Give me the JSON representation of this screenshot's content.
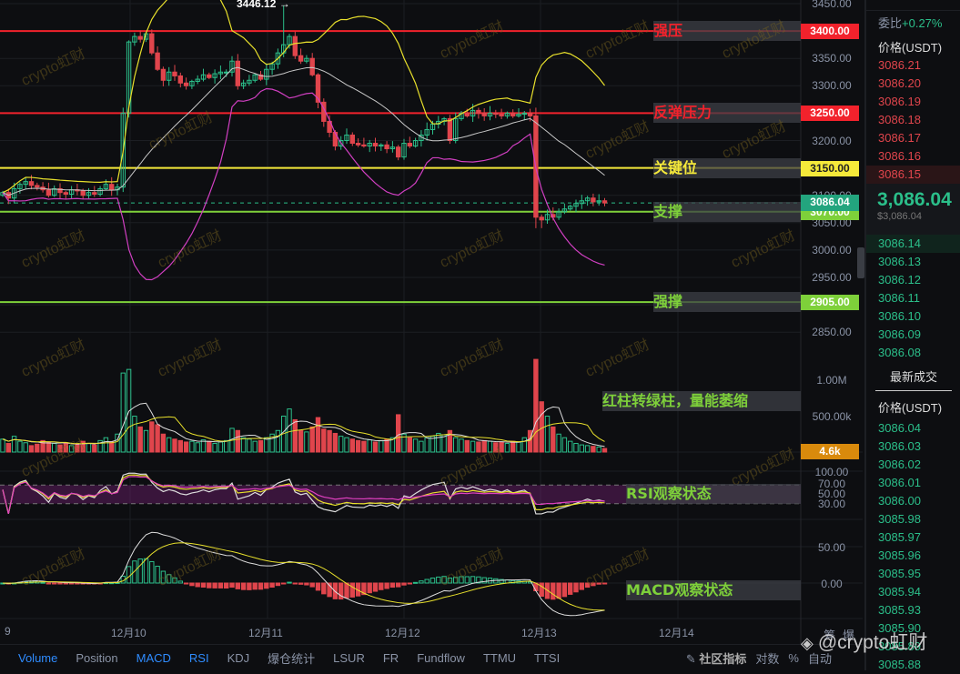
{
  "watermark": "crypto虹财",
  "footer_brand": "@crypto虹财",
  "colors": {
    "up": "#2bbf8a",
    "down": "#e0454c",
    "bg": "#0d0e11",
    "ma": "#c8c8c8",
    "upper": "#e8e02c",
    "lower": "#d13fc2",
    "red_line": "#f2222c",
    "yellow_line": "#f5e93a",
    "green_line": "#7ed03a"
  },
  "price_axis": {
    "ticks": [
      "3450.00",
      "3400.00",
      "3350.00",
      "3300.00",
      "3250.00",
      "3200.00",
      "3150.00",
      "3100.00",
      "3050.00",
      "3000.00",
      "2950.00",
      "2900.00",
      "2850.00"
    ],
    "values": [
      3450,
      3400,
      3350,
      3300,
      3250,
      3200,
      3150,
      3100,
      3050,
      3000,
      2950,
      2900,
      2850
    ]
  },
  "levels": [
    {
      "price": 3400,
      "label": "3400.00",
      "text": "强压",
      "color": "#f2222c",
      "textColor": "#f2222c"
    },
    {
      "price": 3250,
      "label": "3250.00",
      "text": "反弹压力",
      "color": "#f2222c",
      "textColor": "#f2222c"
    },
    {
      "price": 3150,
      "label": "3150.00",
      "text": "关键位",
      "color": "#f5e93a",
      "textColor": "#f5e93a"
    },
    {
      "price": 3070,
      "label": "3070.00",
      "text": "支撑",
      "color": "#7ed03a",
      "textColor": "#7ed03a"
    },
    {
      "price": 2905,
      "label": "2905.00",
      "text": "强撑",
      "color": "#7ed03a",
      "textColor": "#7ed03a"
    }
  ],
  "last_price": {
    "value": 3086.04,
    "label": "3086.04"
  },
  "high_marker": "3446.12 →",
  "volume": {
    "ticks": [
      "1.00M",
      "500.00k"
    ],
    "current": "4.6k",
    "note": "红柱转绿柱，量能萎缩"
  },
  "rsi": {
    "ticks": [
      "100.00",
      "70.00",
      "50.00",
      "30.00"
    ],
    "note": "RSI观察状态"
  },
  "macd": {
    "ticks": [
      "50.00",
      "0.00"
    ],
    "note": "MACD观察状态"
  },
  "x_axis": [
    "9",
    "12月10",
    "12月11",
    "12月12",
    "12月13",
    "12月14"
  ],
  "closes": [
    3105,
    3095,
    3112,
    3120,
    3125,
    3118,
    3115,
    3110,
    3100,
    3112,
    3105,
    3102,
    3110,
    3108,
    3100,
    3105,
    3102,
    3112,
    3120,
    3110,
    3115,
    3250,
    3380,
    3390,
    3385,
    3395,
    3360,
    3330,
    3310,
    3325,
    3318,
    3305,
    3300,
    3308,
    3312,
    3320,
    3315,
    3322,
    3325,
    3325,
    3345,
    3300,
    3305,
    3310,
    3320,
    3312,
    3330,
    3340,
    3360,
    3375,
    3390,
    3355,
    3345,
    3350,
    3320,
    3270,
    3235,
    3215,
    3190,
    3200,
    3210,
    3195,
    3192,
    3190,
    3195,
    3190,
    3192,
    3185,
    3188,
    3170,
    3195,
    3190,
    3200,
    3210,
    3220,
    3230,
    3235,
    3240,
    3200,
    3240,
    3250,
    3245,
    3255,
    3250,
    3245,
    3250,
    3248,
    3245,
    3250,
    3245,
    3248,
    3250,
    3245,
    3060,
    3055,
    3065,
    3060,
    3070,
    3075,
    3080,
    3085,
    3090,
    3095,
    3088,
    3090,
    3086
  ],
  "volumes": [
    180,
    120,
    220,
    150,
    130,
    90,
    110,
    160,
    140,
    120,
    100,
    130,
    90,
    110,
    150,
    120,
    100,
    160,
    200,
    140,
    250,
    1100,
    1150,
    500,
    350,
    300,
    420,
    380,
    250,
    200,
    180,
    160,
    140,
    150,
    130,
    170,
    150,
    120,
    140,
    160,
    330,
    300,
    200,
    180,
    150,
    160,
    200,
    250,
    300,
    500,
    600,
    450,
    300,
    280,
    350,
    480,
    320,
    300,
    260,
    220,
    200,
    180,
    160,
    150,
    170,
    140,
    160,
    180,
    200,
    520,
    250,
    200,
    180,
    150,
    200,
    220,
    260,
    240,
    300,
    200,
    180,
    160,
    150,
    140,
    160,
    150,
    130,
    140,
    120,
    150,
    140,
    200,
    300,
    1290,
    700,
    500,
    350,
    250,
    200,
    150,
    120,
    100,
    90,
    80,
    70,
    50
  ],
  "orderbook": {
    "ratio_label": "委比",
    "ratio_value": "+0.27%",
    "price_header": "价格(USDT)",
    "asks": [
      "3086.21",
      "3086.20",
      "3086.19",
      "3086.18",
      "3086.17",
      "3086.16",
      "3086.15"
    ],
    "last": "3,086.04",
    "last_usd": "$3,086.04",
    "bids": [
      "3086.14",
      "3086.13",
      "3086.12",
      "3086.11",
      "3086.10",
      "3086.09",
      "3086.08"
    ],
    "trades_title": "最新成交",
    "trades_header": "价格(USDT)",
    "trades": [
      "3086.04",
      "3086.03",
      "3086.02",
      "3086.01",
      "3086.00",
      "3085.98",
      "3085.97",
      "3085.96",
      "3085.95",
      "3085.94",
      "3085.93",
      "3085.90",
      "3085.89",
      "3085.88"
    ]
  },
  "tabs": [
    {
      "label": "Volume",
      "active": true
    },
    {
      "label": "Position"
    },
    {
      "label": "MACD",
      "active": true
    },
    {
      "label": "RSI",
      "active": true
    },
    {
      "label": "KDJ"
    },
    {
      "label": "爆仓统计"
    },
    {
      "label": "LSUR"
    },
    {
      "label": "FR"
    },
    {
      "label": "Fundflow"
    },
    {
      "label": "TTMU"
    },
    {
      "label": "TTSI"
    }
  ],
  "tab_right": {
    "community": "社区指标",
    "log": "对数",
    "percent": "%",
    "auto": "自动",
    "chip": "筹",
    "liq": "爆"
  }
}
